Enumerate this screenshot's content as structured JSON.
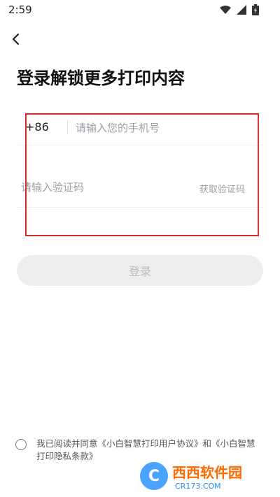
{
  "status_bar": {
    "time": "2:59"
  },
  "header": {
    "title": "登录解锁更多打印内容"
  },
  "form": {
    "country_code": "+86",
    "phone_placeholder": "请输入您的手机号",
    "code_placeholder": "请输入验证码",
    "get_code_label": "获取验证码",
    "login_label": "登录"
  },
  "agreement": {
    "text": "我已阅读并同意《小白智慧打印用户协议》和《小白智慧打印隐私条款》"
  },
  "watermark": {
    "main": "西西软件园",
    "sub": "CR173.COM"
  },
  "colors": {
    "highlight": "#d32f2f",
    "button_disabled": "#eeeeee"
  }
}
